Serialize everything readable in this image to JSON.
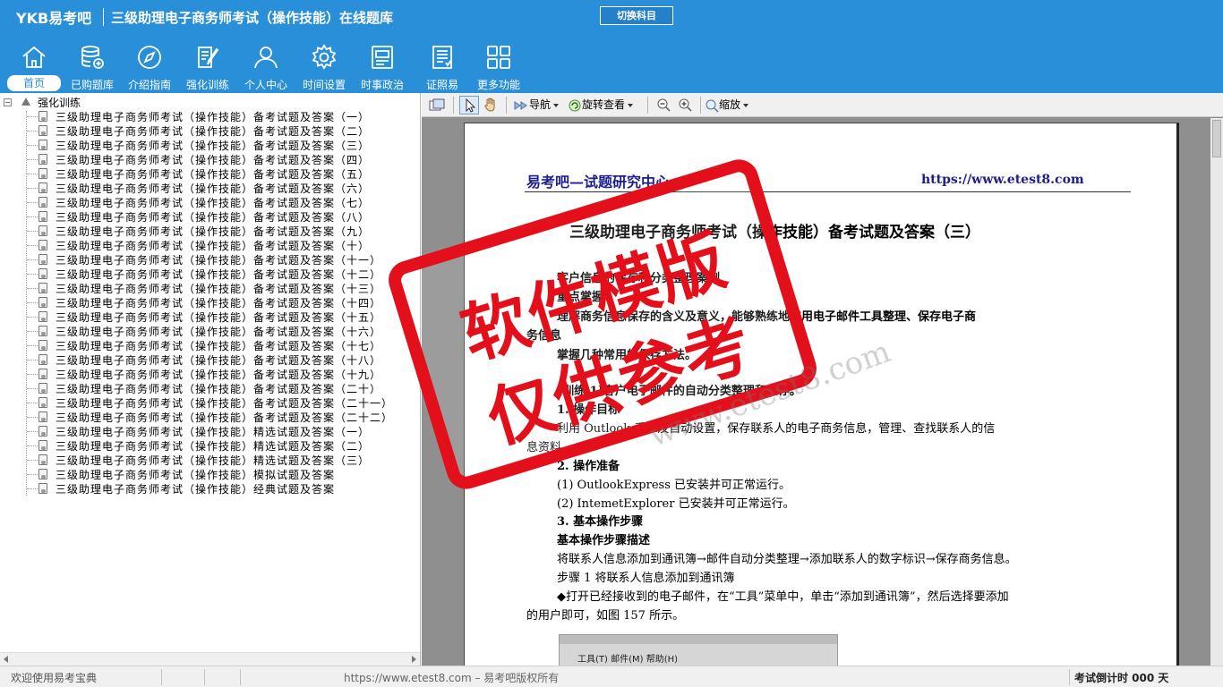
{
  "app": {
    "logo": "YKB易考吧",
    "title": "三级助理电子商务师考试（操作技能）在线题库",
    "switch_label": "切换科目"
  },
  "toolbar": {
    "items": [
      {
        "label": "首页",
        "icon": "home-icon"
      },
      {
        "label": "已购题库",
        "icon": "database-icon"
      },
      {
        "label": "介绍指南",
        "icon": "compass-icon"
      },
      {
        "label": "强化训练",
        "icon": "edit-icon"
      },
      {
        "label": "个人中心",
        "icon": "user-icon"
      },
      {
        "label": "时间设置",
        "icon": "gear-icon"
      },
      {
        "label": "时事政治",
        "icon": "news-icon"
      },
      {
        "label": "证照易",
        "icon": "certificate-icon"
      },
      {
        "label": "更多功能",
        "icon": "grid-icon"
      }
    ],
    "active_index": 0
  },
  "tree": {
    "root_label": "强化训练",
    "items": [
      "三级助理电子商务师考试（操作技能）备考试题及答案（一）",
      "三级助理电子商务师考试（操作技能）备考试题及答案（二）",
      "三级助理电子商务师考试（操作技能）备考试题及答案（三）",
      "三级助理电子商务师考试（操作技能）备考试题及答案（四）",
      "三级助理电子商务师考试（操作技能）备考试题及答案（五）",
      "三级助理电子商务师考试（操作技能）备考试题及答案（六）",
      "三级助理电子商务师考试（操作技能）备考试题及答案（七）",
      "三级助理电子商务师考试（操作技能）备考试题及答案（八）",
      "三级助理电子商务师考试（操作技能）备考试题及答案（九）",
      "三级助理电子商务师考试（操作技能）备考试题及答案（十）",
      "三级助理电子商务师考试（操作技能）备考试题及答案（十一）",
      "三级助理电子商务师考试（操作技能）备考试题及答案（十二）",
      "三级助理电子商务师考试（操作技能）备考试题及答案（十三）",
      "三级助理电子商务师考试（操作技能）备考试题及答案（十四）",
      "三级助理电子商务师考试（操作技能）备考试题及答案（十五）",
      "三级助理电子商务师考试（操作技能）备考试题及答案（十六）",
      "三级助理电子商务师考试（操作技能）备考试题及答案（十七）",
      "三级助理电子商务师考试（操作技能）备考试题及答案（十八）",
      "三级助理电子商务师考试（操作技能）备考试题及答案（十九）",
      "三级助理电子商务师考试（操作技能）备考试题及答案（二十）",
      "三级助理电子商务师考试（操作技能）备考试题及答案（二十一）",
      "三级助理电子商务师考试（操作技能）备考试题及答案（二十二）",
      "三级助理电子商务师考试（操作技能）精选试题及答案（一）",
      "三级助理电子商务师考试（操作技能）精选试题及答案（二）",
      "三级助理电子商务师考试（操作技能）精选试题及答案（三）",
      "三级助理电子商务师考试（操作技能）模拟试题及答案",
      "三级助理电子商务师考试（操作技能）经典试题及答案"
    ]
  },
  "viewer_toolbar": {
    "nav_label": "导航",
    "rotate_label": "旋转查看",
    "zoom_label": "缩放"
  },
  "document": {
    "header_left": "易考吧—试题研究中心",
    "header_right": "https://www.etest8.com",
    "title": "三级助理电子商务师考试（操作技能）备考试题及答案（三）",
    "lines": [
      "客户信息的保存和分类整理案例",
      "重点掌握",
      "理解商务信息保存的含义及意义，能够熟练地应用电子邮件工具整理、保存电子商",
      "务信息",
      "掌握几种常用的保存方法。",
      "[训练 1]客户电子邮件的自动分类整理和保存。",
      "1. 操作目标",
      "利用 Outlook 手工及自动设置，保存联系人的电子商务信息，管理、查找联系人的信",
      "息资料。",
      "2. 操作准备",
      "(1) OutlookExpress 已安装并可正常运行。",
      "(2) IntemetExplorer 已安装并可正常运行。",
      "3. 基本操作步骤",
      "基本操作步骤描述",
      "将联系人信息添加到通讯簿→邮件自动分类整理→添加联系人的数字标识→保存商务信息。",
      "步骤 1 将联系人信息添加到通讯簿",
      "◆打开已经接收到的电子邮件，在“工具”菜单中，单击“添加到通讯簿”，然后选择要添加",
      "的用户即可，如图 157 所示。"
    ],
    "screenshot_menu": "工具(T)  邮件(M)  帮助(H)"
  },
  "watermark": {
    "line1": "软件模版",
    "line2": "仅供参考",
    "url": "www.etest8.com"
  },
  "status": {
    "left": "欢迎使用易考宝典",
    "center": "https://www.etest8.com – 易考吧版权所有",
    "right": "考试倒计时 000 天"
  },
  "colors": {
    "brand_blue": "#2a8fd9",
    "stamp_red": "#e3101c"
  }
}
